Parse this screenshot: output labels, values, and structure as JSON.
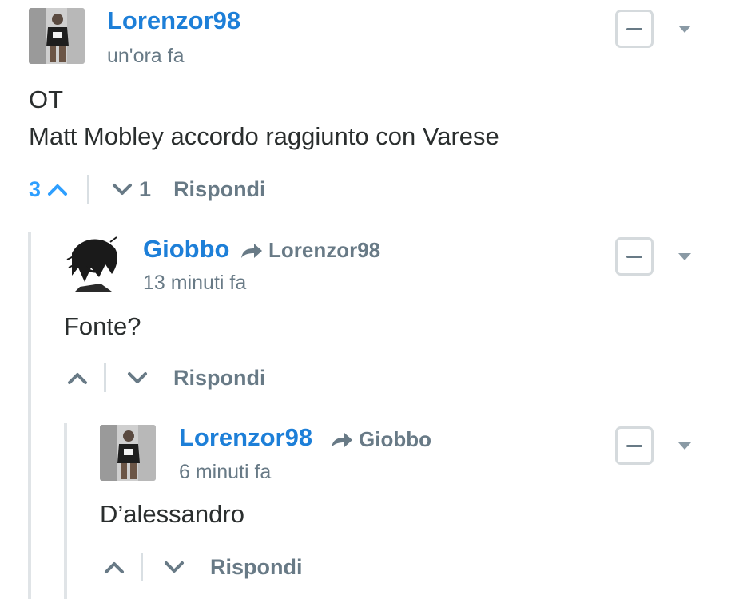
{
  "comments": [
    {
      "author": "Lorenzor98",
      "reply_to": "",
      "time": "un'ora fa",
      "body_lines": [
        "OT",
        "Matt Mobley accordo raggiunto con Varese"
      ],
      "upvotes": "3",
      "downvotes": "1",
      "reply_label": "Rispondi",
      "avatar_icon": "basketball-player-avatar"
    },
    {
      "author": "Giobbo",
      "reply_to": "Lorenzor98",
      "time": "13 minuti fa",
      "body_lines": [
        "Fonte?"
      ],
      "upvotes": "",
      "downvotes": "",
      "reply_label": "Rispondi",
      "avatar_icon": "manga-sketch-avatar"
    },
    {
      "author": "Lorenzor98",
      "reply_to": "Giobbo",
      "time": "6 minuti fa",
      "body_lines": [
        "D’alessandro"
      ],
      "upvotes": "",
      "downvotes": "",
      "reply_label": "Rispondi",
      "avatar_icon": "basketball-player-avatar"
    }
  ],
  "colors": {
    "author": "#1d7fd8",
    "upvote_active": "#2e9fff",
    "muted": "#687a86",
    "thread_line": "#e0e4e7"
  }
}
